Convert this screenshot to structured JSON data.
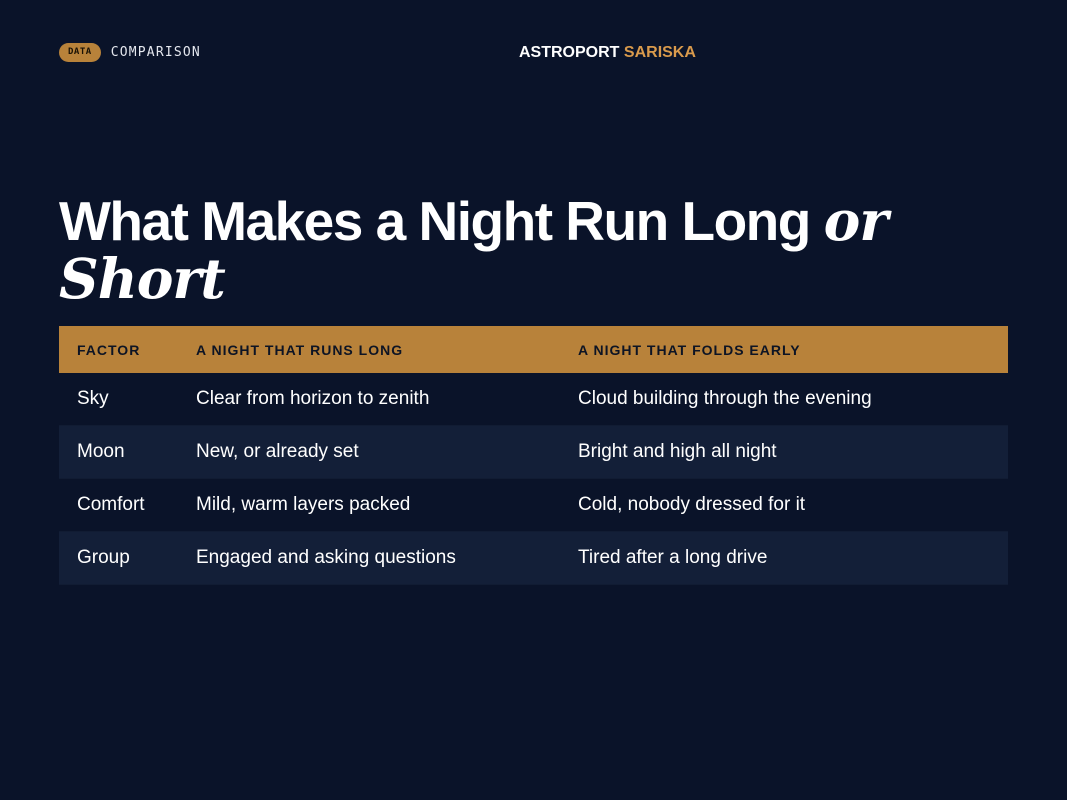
{
  "header": {
    "badge": "DATA",
    "section": "COMPARISON",
    "brand_primary": "ASTROPORT",
    "brand_accent": "SARISKA"
  },
  "title": {
    "main": "What Makes a Night Run Long ",
    "italic": "or Short"
  },
  "table": {
    "headers": [
      "FACTOR",
      "A NIGHT THAT RUNS LONG",
      "A NIGHT THAT FOLDS EARLY"
    ],
    "rows": [
      [
        "Sky",
        "Clear from horizon to zenith",
        "Cloud building through the evening"
      ],
      [
        "Moon",
        "New, or already set",
        "Bright and high all night"
      ],
      [
        "Comfort",
        "Mild, warm layers packed",
        "Cold, nobody dressed for it"
      ],
      [
        "Group",
        "Engaged and asking questions",
        "Tired after a long drive"
      ]
    ]
  },
  "colors": {
    "background": "#0a1329",
    "accent": "#b8823a",
    "brand_accent": "#d99a4c",
    "row_alt": "#131f38"
  }
}
